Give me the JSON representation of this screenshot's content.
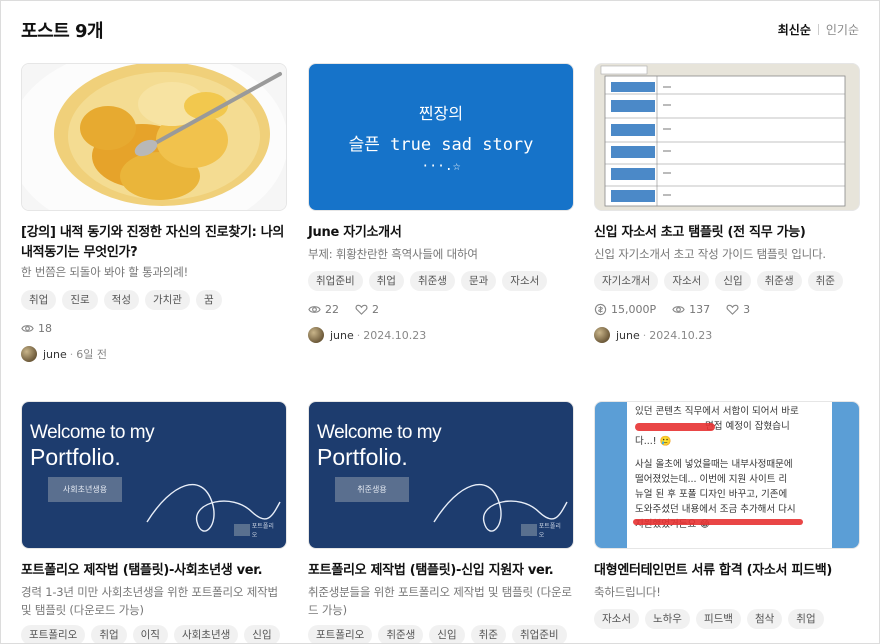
{
  "header": {
    "title": "포스트 9개",
    "sort_active": "최신순",
    "sort_other": "인기순"
  },
  "cards": [
    {
      "title": "[강의] 내적 동기와 진정한 자신의 진로찾기: 나의 내적동기는 무엇인가?",
      "desc": "한 번쯤은 되돌아 봐야 할 통과의례!",
      "tags": [
        "취업",
        "진로",
        "적성",
        "가치관",
        "꿈"
      ],
      "views": "18",
      "author": "june",
      "date": "6일 전"
    },
    {
      "title": "June 자기소개서",
      "desc": "부제: 휘황찬란한 흑역사들에 대하여",
      "thumb_lines": [
        "찐장의",
        "슬픈 true sad story",
        "···.☆"
      ],
      "tags": [
        "취업준비",
        "취업",
        "취준생",
        "문과",
        "자소서"
      ],
      "views": "22",
      "likes": "2",
      "author": "june",
      "date": "2024.10.23"
    },
    {
      "title": "신입 자소서 초고 탬플릿 (전 직무 가능)",
      "desc": "신입 자기소개서 초고 작성 가이드 탬플릿 입니다.",
      "tags": [
        "자기소개서",
        "자소서",
        "신입",
        "취준생",
        "취준"
      ],
      "price": "15,000P",
      "views": "137",
      "likes": "3",
      "author": "june",
      "date": "2024.10.23"
    },
    {
      "title": "포트폴리오 제작법 (탬플릿)-사회초년생 ver.",
      "desc": "경력 1-3년 미만 사회초년생을 위한 포트폴리오 제작법 및 탬플릿 (다운로드 가능)",
      "thumb_welcome": "Welcome to my",
      "thumb_portfolio": "Portfolio.",
      "thumb_box": "사회초년생용",
      "thumb_badge": "포트폴리오",
      "tags": [
        "포트폴리오",
        "취업",
        "이직",
        "사회초년생",
        "신입"
      ]
    },
    {
      "title": "포트폴리오 제작법 (탬플릿)-신입 지원자 ver.",
      "desc": "취준생분들을 위한 포트폴리오 제작법 및 탬플릿 (다운로드 가능)",
      "thumb_welcome": "Welcome to my",
      "thumb_portfolio": "Portfolio.",
      "thumb_box": "취준생용",
      "thumb_badge": "포트폴리오",
      "tags": [
        "포트폴리오",
        "취준생",
        "신입",
        "취준",
        "취업준비"
      ]
    },
    {
      "title": "대형엔터테인먼트 서류 합격 (자소서 피드백)",
      "desc": "축하드립니다!",
      "thumb_text": [
        "있던 콘텐츠 직무에서 서합이 되어서 바로",
        "면접 예정이 잡혔습니",
        "다...! 🥲",
        "",
        "사실 올초에 넣었을때는 내부사정때문에",
        "떨어졌었는데... 이번에 지원 사이트 리",
        "뉴얼 된 후 포폴 디자인 바꾸고, 기존에",
        "도와주셨던 내용에서 조금 추가해서 다시",
        "지원했었거든요 😂"
      ],
      "tags": [
        "자소서",
        "노하우",
        "피드백",
        "첨삭",
        "취업"
      ]
    }
  ],
  "colors": {
    "blue_thumb": "#1673c9",
    "portfolio_bg": "#1d3c6e",
    "chat_bg": "#5b9ed6"
  }
}
